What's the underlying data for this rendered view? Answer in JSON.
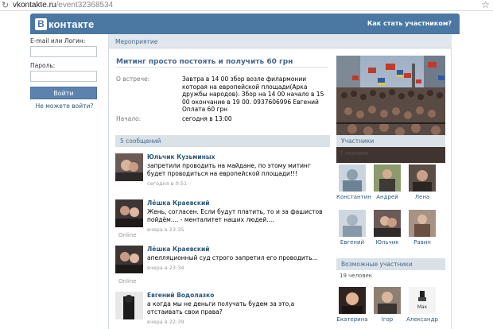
{
  "browser": {
    "url_host": "vkontakte.ru",
    "url_path": "/event32368534"
  },
  "header": {
    "logo_letter": "В",
    "logo_word": "контакте",
    "join_link": "Как стать участником?"
  },
  "login": {
    "email_label": "E-mail или Логин:",
    "password_label": "Пароль:",
    "button": "Войти",
    "forgot": "Не можете войти?"
  },
  "breadcrumb": "Мероприятие",
  "event": {
    "title": "Митинг просто постоять и получить 60 грн",
    "meet_label": "О встрече:",
    "meet_text": "Завтра в 14 00 збор возле филармонии которая на европейской площади(Арка дружбы народов). Збор на 14 00 начало в 15 00 окончание в 19 00. 0937606996 Евгений Оплата 60 грн",
    "start_label": "Начало:",
    "start_text": "сегодня в 13:00"
  },
  "wall": {
    "header": "5 сообщений",
    "posts": [
      {
        "author": "Юльчик Кузьминых",
        "text": "запретили проводить на майдане, по этому митинг будет проводиться на европейской площади!!!",
        "time": "сегодня в 0:51",
        "online": ""
      },
      {
        "author": "Лёшка Краевский",
        "text": "Жень, согласен. Если будут платить, то и за фашистов пойдём.... - менталитет наших людей....",
        "time": "вчера в 23:35",
        "online": "Online"
      },
      {
        "author": "Лёшка Краевский",
        "text": "апелляционный суд строго запретил его проводить...",
        "time": "вчера в 23:34",
        "online": "Online"
      },
      {
        "author": "Евгений Водолазко",
        "text": "а когда мы не деньги получать будем за это,а отстаивать свои права?",
        "time": "вчера в 22:39",
        "online": ""
      }
    ]
  },
  "members": {
    "header": "Участники",
    "count": "7 человек",
    "people": [
      "Константин",
      "Андрей",
      "Лена",
      "Евгений",
      "Юльчик",
      "Равин"
    ]
  },
  "maybe": {
    "header": "Возможные участники",
    "count": "19 человек",
    "people": [
      "Екатерина",
      "Ігор",
      "Александр"
    ],
    "pic_caption": "Мак"
  }
}
